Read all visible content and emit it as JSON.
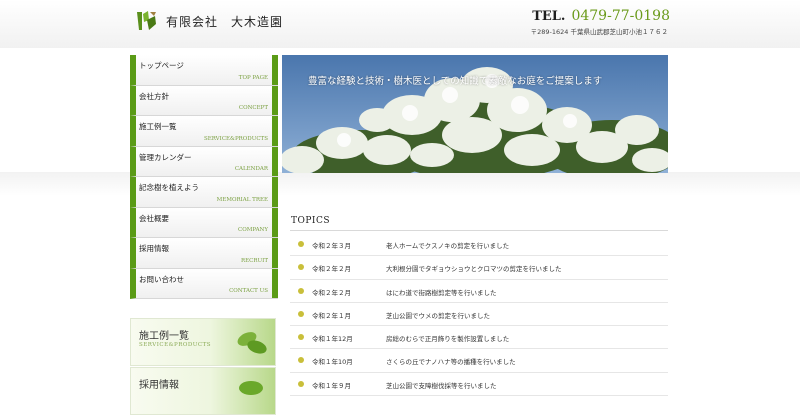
{
  "header": {
    "company": "有限会社　大木造園",
    "tel_label": "TEL.",
    "tel_number": "0479-77-0198",
    "address": "〒289-1624 千葉県山武郡芝山町小池１７６２"
  },
  "nav": [
    {
      "jp": "トップページ",
      "en": "TOP PAGE"
    },
    {
      "jp": "会社方針",
      "en": "CONCEPT"
    },
    {
      "jp": "施工例一覧",
      "en": "SERVICE&PRODUCTS"
    },
    {
      "jp": "管理カレンダー",
      "en": "CALENDAR"
    },
    {
      "jp": "記念樹を植えよう",
      "en": "MEMORIAL TREE"
    },
    {
      "jp": "会社概要",
      "en": "COMPANY"
    },
    {
      "jp": "採用情報",
      "en": "RECRUIT"
    },
    {
      "jp": "お問い合わせ",
      "en": "CONTACT US"
    }
  ],
  "banners": [
    {
      "jp": "施工例一覧",
      "en": "SERVICE&PRODUCTS"
    },
    {
      "jp": "採用情報",
      "en": ""
    }
  ],
  "hero": {
    "caption": "豊富な経験と技術・樹木医としての知識で素敵なお庭をご提案します"
  },
  "topics": {
    "title": "TOPICS",
    "items": [
      {
        "date": "令和２年３月",
        "text": "老人ホームでクスノキの剪定を行いました"
      },
      {
        "date": "令和２年２月",
        "text": "大利根分園でタギョウショウとクロマツの剪定を行いました"
      },
      {
        "date": "令和２年２月",
        "text": "はにわ道で街路樹剪定等を行いました"
      },
      {
        "date": "令和２年１月",
        "text": "芝山公園でウメの剪定を行いました"
      },
      {
        "date": "令和１年12月",
        "text": "房総のむらで正月飾りを製作設置しました"
      },
      {
        "date": "令和１年10月",
        "text": "さくらの丘でナノハナ等の播種を行いました"
      },
      {
        "date": "令和１年９月",
        "text": "芝山公園で支障樹伐採等を行いました"
      }
    ]
  },
  "colors": {
    "accent_green": "#5a9b16",
    "tel_green": "#6a9a1a",
    "bullet": "#c9bf3a"
  }
}
